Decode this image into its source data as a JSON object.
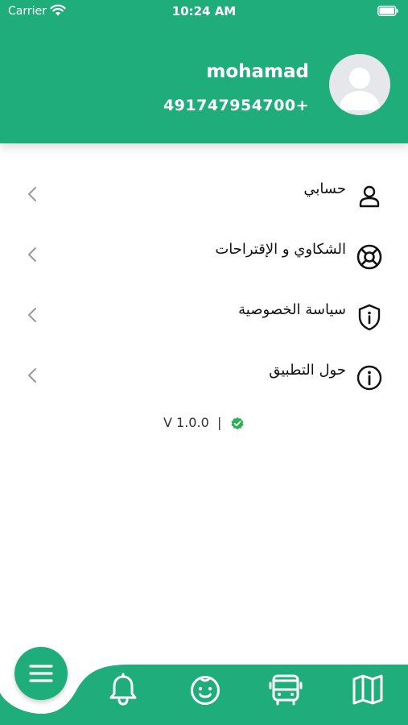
{
  "status_bar": {
    "carrier": "Carrier",
    "time": "10:24 AM"
  },
  "profile": {
    "name": "mohamad",
    "phone": "491747954700+"
  },
  "menu": {
    "items": [
      {
        "label": "حسابي",
        "icon": "user-icon"
      },
      {
        "label": "الشكاوي و الإقتراحات",
        "icon": "lifebuoy-icon"
      },
      {
        "label": "سياسة الخصوصية",
        "icon": "shield-info-icon"
      },
      {
        "label": "حول التطبيق",
        "icon": "info-icon"
      }
    ]
  },
  "version": {
    "text": "V 1.0.0",
    "separator": "|"
  },
  "tab_bar": {
    "tabs": [
      {
        "icon": "menu-icon"
      },
      {
        "icon": "bell-icon"
      },
      {
        "icon": "child-face-icon"
      },
      {
        "icon": "bus-icon"
      },
      {
        "icon": "map-icon"
      }
    ]
  },
  "colors": {
    "brand": "#20ad7c",
    "text": "#111111",
    "chevron": "#9a9a9a",
    "verified": "#2fae57"
  }
}
